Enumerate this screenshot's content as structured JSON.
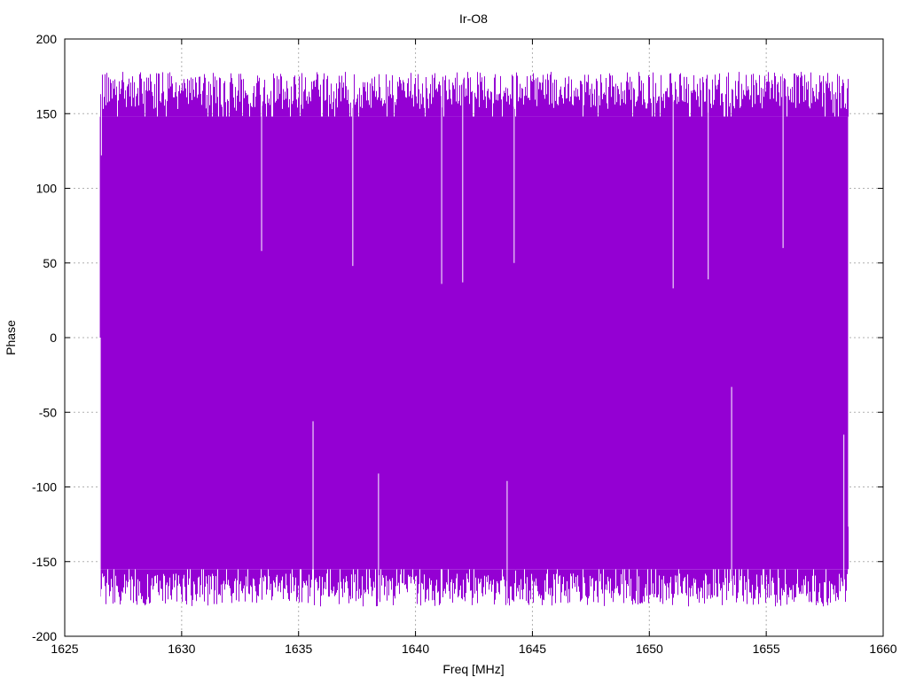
{
  "chart_data": {
    "type": "line",
    "title": "Ir-O8",
    "xlabel": "Freq [MHz]",
    "ylabel": "Phase",
    "xlim": [
      1625,
      1660
    ],
    "ylim": [
      -200,
      200
    ],
    "x_ticks": [
      1625,
      1630,
      1635,
      1640,
      1645,
      1650,
      1655,
      1660
    ],
    "y_ticks": [
      -200,
      -150,
      -100,
      -50,
      0,
      50,
      100,
      150,
      200
    ],
    "x_tick_labels": [
      "1625",
      "1630",
      "1635",
      "1640",
      "1645",
      "1650",
      "1655",
      "1660"
    ],
    "y_tick_labels": [
      "-200",
      "-150",
      "-100",
      "-50",
      "0",
      "50",
      "100",
      "150",
      "200"
    ],
    "grid": true,
    "legend": "none",
    "series": [
      {
        "color": "#9400d3",
        "description_range": {
          "x_start": 1626.5,
          "x_end": 1658.5
        },
        "envelope": {
          "upper_typical": 178,
          "lower_typical": -180
        },
        "notable_points": [
          {
            "x": 1626.5,
            "y": 0
          },
          {
            "x": 1626.55,
            "y": 122
          },
          {
            "x": 1633.4,
            "y": 58
          },
          {
            "x": 1637.3,
            "y": 48
          },
          {
            "x": 1641.1,
            "y": 36
          },
          {
            "x": 1642.0,
            "y": 37
          },
          {
            "x": 1644.2,
            "y": 50
          },
          {
            "x": 1651.0,
            "y": 33
          },
          {
            "x": 1652.5,
            "y": 39
          },
          {
            "x": 1655.7,
            "y": 60
          },
          {
            "x": 1635.6,
            "y": -56
          },
          {
            "x": 1653.5,
            "y": -33
          },
          {
            "x": 1658.3,
            "y": -65
          },
          {
            "x": 1638.4,
            "y": -91
          },
          {
            "x": 1643.9,
            "y": -96
          }
        ]
      }
    ]
  }
}
